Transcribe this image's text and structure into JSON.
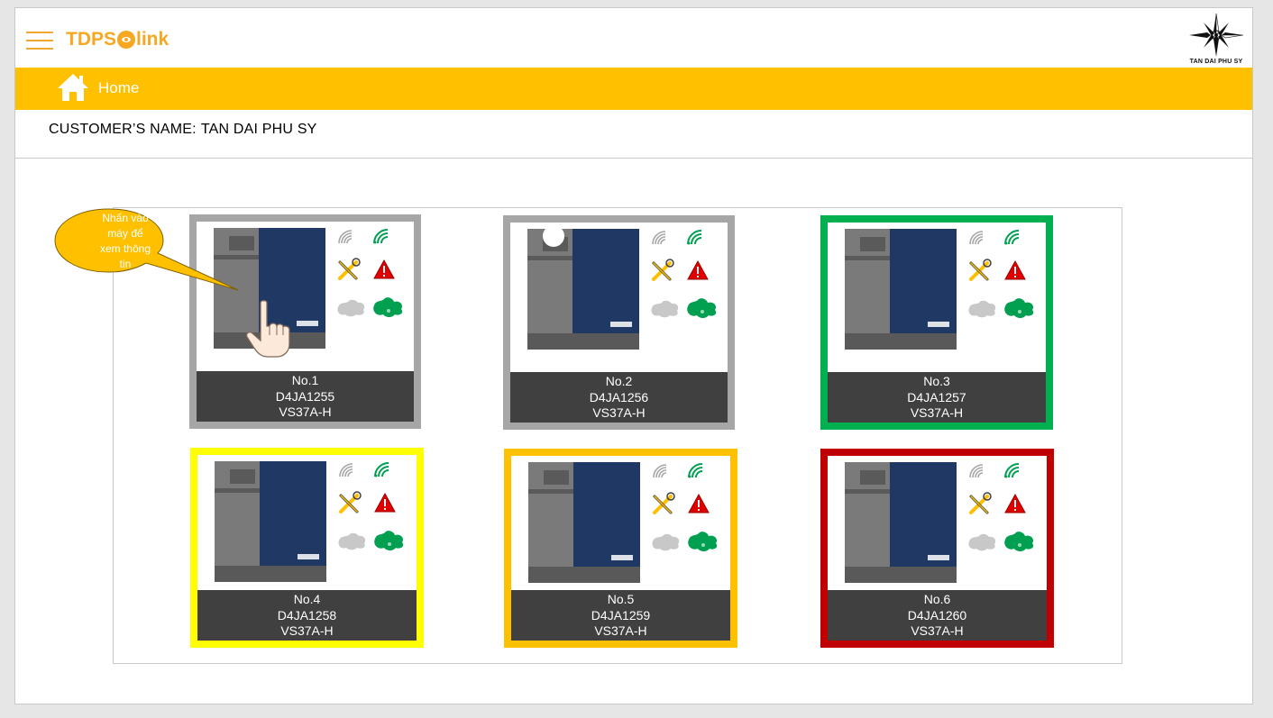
{
  "header": {
    "brand_left": "TDPS",
    "brand_right": "link",
    "logo_caption": "TAN DAI PHU SY"
  },
  "nav": {
    "home_label": "Home"
  },
  "customer": {
    "label": "CUSTOMER’S NAME:",
    "name": "TAN DAI PHU SY"
  },
  "tooltip": {
    "lines": [
      "Nhấn vào",
      "máy để",
      "xem thông",
      "tin"
    ]
  },
  "machines": [
    {
      "no": "No.1",
      "serial": "D4JA1255",
      "model": "VS37A-H",
      "status_color": "#a6a6a6"
    },
    {
      "no": "No.2",
      "serial": "D4JA1256",
      "model": "VS37A-H",
      "status_color": "#a6a6a6"
    },
    {
      "no": "No.3",
      "serial": "D4JA1257",
      "model": "VS37A-H",
      "status_color": "#00b050"
    },
    {
      "no": "No.4",
      "serial": "D4JA1258",
      "model": "VS37A-H",
      "status_color": "#ffff00"
    },
    {
      "no": "No.5",
      "serial": "D4JA1259",
      "model": "VS37A-H",
      "status_color": "#ffc000"
    },
    {
      "no": "No.6",
      "serial": "D4JA1260",
      "model": "VS37A-H",
      "status_color": "#c00000"
    }
  ],
  "colors": {
    "accent": "#ffc000",
    "brand": "#f7a823",
    "label_bg": "#404040",
    "machine_blue": "#203864"
  }
}
